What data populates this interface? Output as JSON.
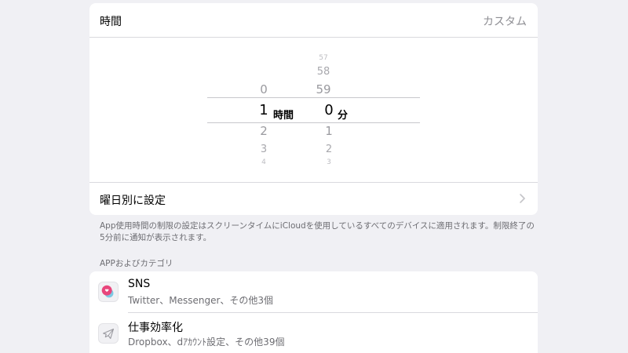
{
  "time_row": {
    "label": "時間",
    "value": "カスタム"
  },
  "picker": {
    "hours": {
      "above": "0",
      "selected": "1",
      "below": [
        "2",
        "3",
        "4"
      ],
      "unit": "時間"
    },
    "minutes": {
      "above": [
        "57",
        "58",
        "59"
      ],
      "selected": "0",
      "below": [
        "1",
        "2",
        "3"
      ],
      "unit": "分"
    }
  },
  "weekday_row": {
    "label": "曜日別に設定",
    "chevron_icon": "chevron-right-icon"
  },
  "footnote": "App使用時間の制限の設定はスクリーンタイムにiCloudを使用しているすべてのデバイスに適用されます。制限終了の5分前に通知が表示されます。",
  "apps_section": {
    "header": "APPおよびカテゴリ",
    "items": [
      {
        "title": "SNS",
        "subtitle": "Twitter、Messenger、その他3個",
        "icon": "social-chat-icon"
      },
      {
        "title": "仕事効率化",
        "subtitle": "Dropbox、dｱｶｳﾝﾄ設定、その他39個",
        "icon": "paper-plane-icon"
      }
    ]
  },
  "colors": {
    "background": "#f0f0f4",
    "card": "#ffffff",
    "secondary_text": "#8e8e93",
    "social_icon": "#e8467c"
  }
}
